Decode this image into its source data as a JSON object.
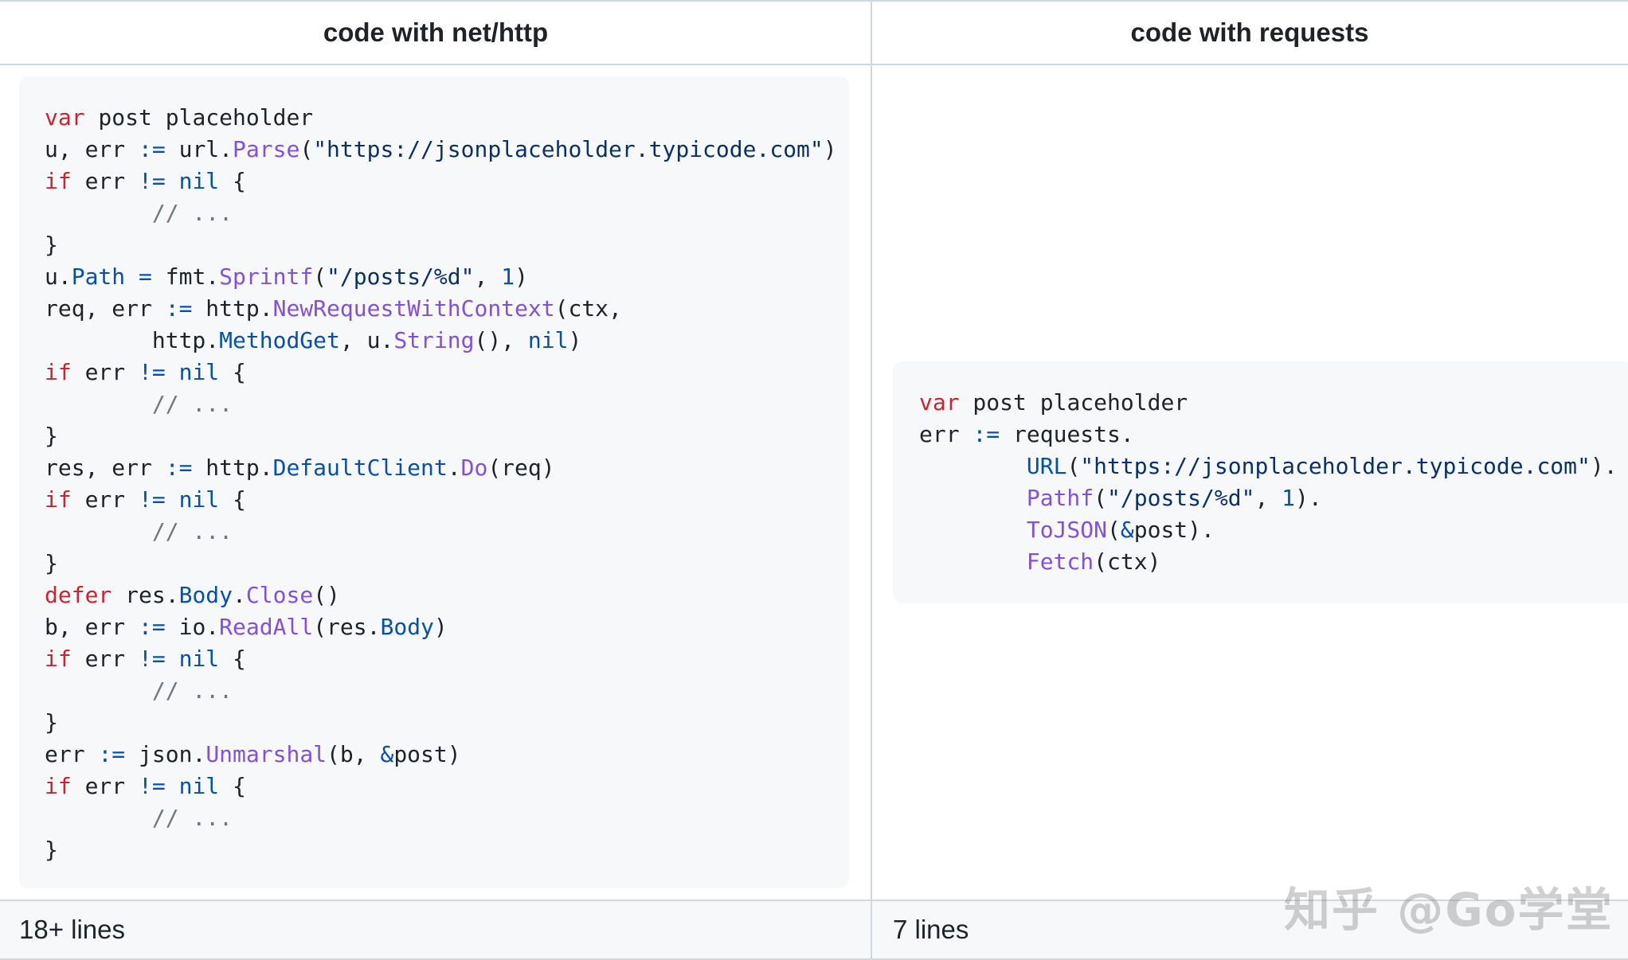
{
  "headers": {
    "left": "code with net/http",
    "right": "code with requests"
  },
  "footers": {
    "left": "18+ lines",
    "right": "7 lines"
  },
  "watermark": "知乎 @Go学堂",
  "code_left": {
    "var_kw": "var",
    "l1_rest": " post placeholder",
    "l2_a": "u, err ",
    "assign": ":=",
    "l2_b": " url.",
    "l2_fn": "Parse",
    "l2_c": "(",
    "l2_str": "\"https://jsonplaceholder.typicode.com\"",
    "l2_d": ")",
    "if_kw": "if",
    "err_ne": " err ",
    "ne": "!=",
    "nil": "nil",
    "brace_open": " {",
    "comment": "// ...",
    "brace_close": "}",
    "l6_a": "u.",
    "l6_fld": "Path",
    "l6_eq": " = ",
    "l6_b": "fmt.",
    "l6_fn": "Sprintf",
    "l6_c": "(",
    "l6_str": "\"/posts/%d\"",
    "l6_d": ", ",
    "l6_num": "1",
    "l6_e": ")",
    "l7_a": "req, err ",
    "l7_b": " http.",
    "l7_fn": "NewRequestWithContext",
    "l7_c": "(ctx,",
    "l8_a": "http.",
    "l8_fld": "MethodGet",
    "l8_b": ", u.",
    "l8_fn": "String",
    "l8_c": "(), ",
    "l8_d": ")",
    "l12_a": "res, err ",
    "l12_b": " http.",
    "l12_fld": "DefaultClient",
    "l12_c": ".",
    "l12_fn": "Do",
    "l12_d": "(req)",
    "defer_kw": "defer",
    "l16_a": " res.",
    "l16_fld": "Body",
    "l16_b": ".",
    "l16_fn": "Close",
    "l16_c": "()",
    "l17_a": "b, err ",
    "l17_b": " io.",
    "l17_fn": "ReadAll",
    "l17_c": "(res.",
    "l17_fld": "Body",
    "l17_d": ")",
    "l21_a": "err ",
    "l21_b": " json.",
    "l21_fn": "Unmarshal",
    "l21_c": "(b, ",
    "l21_amp": "&",
    "l21_d": "post)"
  },
  "code_right": {
    "var_kw": "var",
    "l1_rest": " post placeholder",
    "l2_a": "err ",
    "assign": ":=",
    "l2_b": " requests.",
    "l3_fn": "URL",
    "l3_a": "(",
    "l3_str": "\"https://jsonplaceholder.typicode.com\"",
    "l3_b": ").",
    "l4_fn": "Pathf",
    "l4_a": "(",
    "l4_str": "\"/posts/%d\"",
    "l4_b": ", ",
    "l4_num": "1",
    "l4_c": ").",
    "l5_fn": "ToJSON",
    "l5_a": "(",
    "l5_amp": "&",
    "l5_b": "post).",
    "l6_fn": "Fetch",
    "l6_a": "(ctx)"
  }
}
